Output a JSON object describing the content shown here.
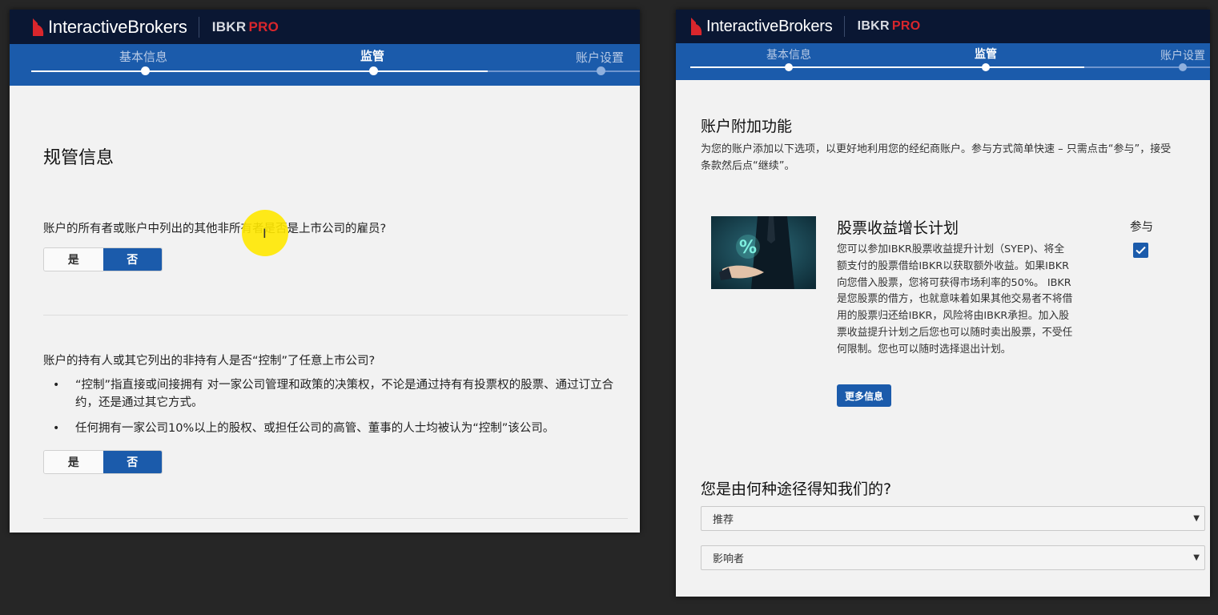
{
  "brand": {
    "logo_text": "InteractiveBrokers",
    "product": "IBKR",
    "product_tier": "PRO",
    "colors": {
      "navy": "#0a1733",
      "blue": "#1b5bab",
      "red": "#d9262c"
    }
  },
  "left": {
    "steps": [
      {
        "label": "基本信息",
        "state": "done"
      },
      {
        "label": "监管",
        "state": "active"
      },
      {
        "label": "账户设置",
        "state": "pending"
      }
    ],
    "section_title": "规管信息",
    "q1": {
      "text": "账户的所有者或账户中列出的其他非所有者是否是上市公司的雇员?",
      "yes": "是",
      "no": "否",
      "selected": "否"
    },
    "q2": {
      "text": "账户的持有人或其它列出的非持有人是否“控制”了任意上市公司?",
      "bullets": [
        "“控制”指直接或间接拥有 对一家公司管理和政策的决策权，不论是通过持有有投票权的股票、通过订立合约，还是通过其它方式。",
        "任何拥有一家公司10%以上的股权、或担任公司的高管、董事的人士均被认为“控制”该公司。"
      ],
      "yes": "是",
      "no": "否",
      "selected": "否"
    }
  },
  "right": {
    "steps": [
      {
        "label": "基本信息",
        "state": "done"
      },
      {
        "label": "监管",
        "state": "active"
      },
      {
        "label": "账户设置",
        "state": "pending"
      }
    ],
    "section_title": "账户附加功能",
    "section_desc_line1": "为您的账户添加以下选项，以更好地利用您的经纪商账户。参与方式简单快速 – 只需点击“参与”，接受",
    "section_desc_line2": "条款然后点“继续”。",
    "promo": {
      "title": "股票收益增长计划",
      "body": "您可以参加IBKR股票收益提升计划（SYEP)、将全额支付的股票借给IBKR以获取额外收益。如果IBKR向您借入股票，您将可获得市场利率的50%。 IBKR是您股票的借方，也就意味着如果其他交易者不将借用的股票归还给IBKR，风险将由IBKR承担。加入股票收益提升计划之后您也可以随时卖出股票，不受任何限制。您也可以随时选择退出计划。",
      "more_button": "更多信息",
      "image_glyph": "%",
      "participate_label": "参与",
      "participate_checked": true
    },
    "referral": {
      "title": "您是由何种途径得知我们的?",
      "select1": "推荐",
      "select2": "影响者"
    }
  }
}
